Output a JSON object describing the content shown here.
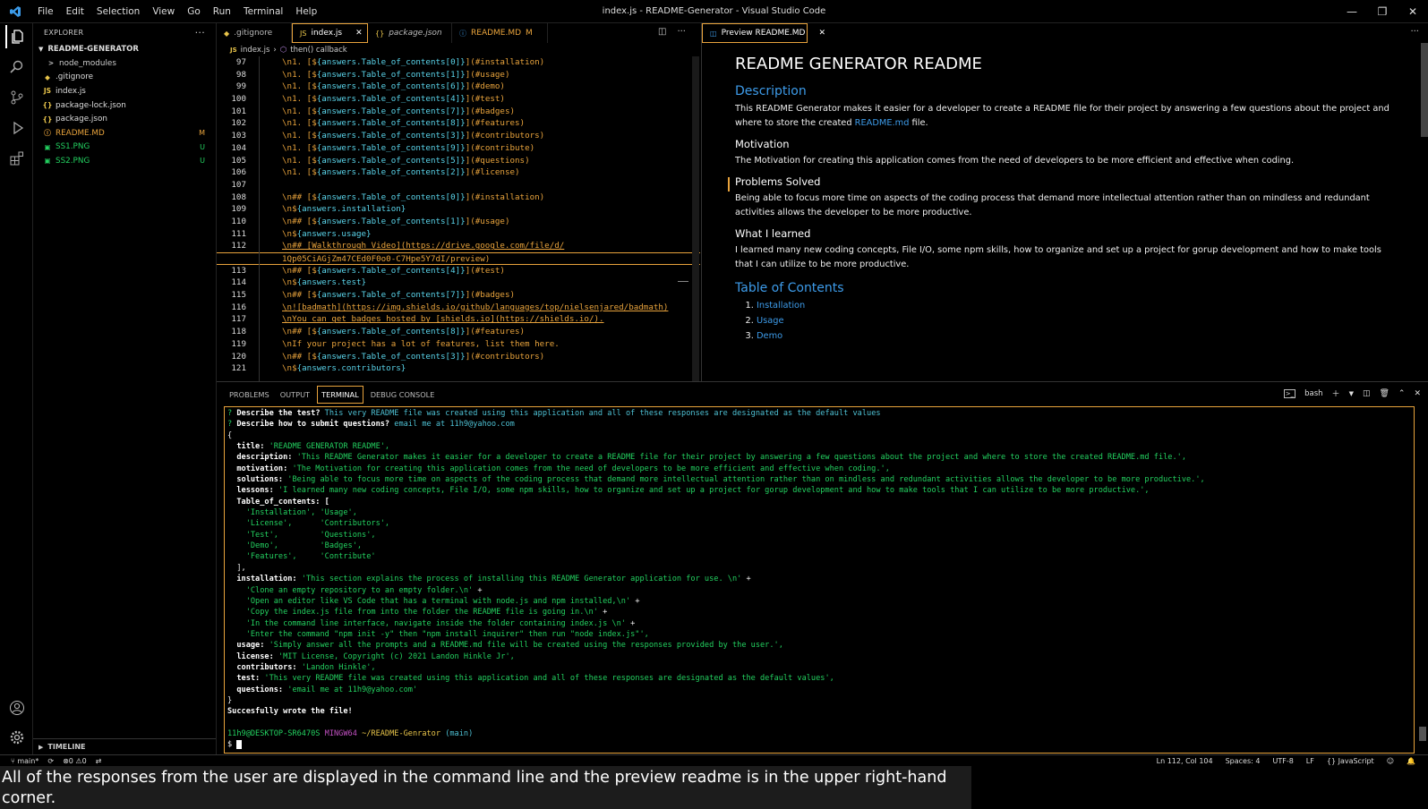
{
  "window": {
    "title": "index.js - README-Generator - Visual Studio Code",
    "menu": [
      "File",
      "Edit",
      "Selection",
      "View",
      "Go",
      "Run",
      "Terminal",
      "Help"
    ]
  },
  "sidebar": {
    "header": "EXPLORER",
    "root": "README-GENERATOR",
    "items": [
      {
        "label": "node_modules",
        "icon": ">",
        "color": "#bbbbbb",
        "badge": "",
        "badge_color": "#bbbbbb"
      },
      {
        "label": ".gitignore",
        "icon": "◆",
        "color": "#e8c44a",
        "badge": "",
        "badge_color": "#bbbbbb"
      },
      {
        "label": "index.js",
        "icon": "JS",
        "color": "#e8c44a",
        "badge": "",
        "badge_color": "#bbbbbb"
      },
      {
        "label": "package-lock.json",
        "icon": "{}",
        "color": "#e8c44a",
        "badge": "",
        "badge_color": "#bbbbbb"
      },
      {
        "label": "package.json",
        "icon": "{}",
        "color": "#e8c44a",
        "badge": "",
        "badge_color": "#bbbbbb"
      },
      {
        "label": "README.MD",
        "icon": "ⓘ",
        "color": "#e8a33c",
        "badge": "M",
        "badge_color": "#e8a33c"
      },
      {
        "label": "SS1.PNG",
        "icon": "▣",
        "color": "#23d160",
        "badge": "U",
        "badge_color": "#23d160"
      },
      {
        "label": "SS2.PNG",
        "icon": "▣",
        "color": "#23d160",
        "badge": "U",
        "badge_color": "#23d160"
      }
    ],
    "timeline": "TIMELINE"
  },
  "tabs_left": [
    {
      "label": ".gitignore",
      "icon": "◆",
      "active": false
    },
    {
      "label": "index.js",
      "icon": "JS",
      "active": true
    },
    {
      "label": "package.json",
      "icon": "{}",
      "active": false
    },
    {
      "label": "README.MD",
      "icon": "ⓘ",
      "badge": "M",
      "active": false
    }
  ],
  "tabs_right": [
    {
      "label": "Preview README.MD",
      "icon": "◫",
      "active": true
    }
  ],
  "breadcrumb": {
    "file": "index.js",
    "symbol": "then() callback"
  },
  "code": [
    {
      "n": "97",
      "a": "\\n1. [$",
      "v": "{answers.Table_of_contents[0]}",
      "b": "](#installation)"
    },
    {
      "n": "98",
      "a": "\\n1. [$",
      "v": "{answers.Table_of_contents[1]}",
      "b": "](#usage)"
    },
    {
      "n": "99",
      "a": "\\n1. [$",
      "v": "{answers.Table_of_contents[6]}",
      "b": "](#demo)"
    },
    {
      "n": "100",
      "a": "\\n1. [$",
      "v": "{answers.Table_of_contents[4]}",
      "b": "](#test)"
    },
    {
      "n": "101",
      "a": "\\n1. [$",
      "v": "{answers.Table_of_contents[7]}",
      "b": "](#badges)"
    },
    {
      "n": "102",
      "a": "\\n1. [$",
      "v": "{answers.Table_of_contents[8]}",
      "b": "](#features)"
    },
    {
      "n": "103",
      "a": "\\n1. [$",
      "v": "{answers.Table_of_contents[3]}",
      "b": "](#contributors)"
    },
    {
      "n": "104",
      "a": "\\n1. [$",
      "v": "{answers.Table_of_contents[9]}",
      "b": "](#contribute)"
    },
    {
      "n": "105",
      "a": "\\n1. [$",
      "v": "{answers.Table_of_contents[5]}",
      "b": "](#questions)"
    },
    {
      "n": "106",
      "a": "\\n1. [$",
      "v": "{answers.Table_of_contents[2]}",
      "b": "](#license)"
    },
    {
      "n": "107",
      "a": "",
      "v": "",
      "b": ""
    },
    {
      "n": "108",
      "a": "\\n## [$",
      "v": "{answers.Table_of_contents[0]}",
      "b": "](#installation)"
    },
    {
      "n": "109",
      "a": "\\n$",
      "v": "{answers.installation}",
      "b": ""
    },
    {
      "n": "110",
      "a": "\\n## [$",
      "v": "{answers.Table_of_contents[1]}",
      "b": "](#usage)"
    },
    {
      "n": "111",
      "a": "\\n$",
      "v": "{answers.usage}",
      "b": ""
    },
    {
      "n": "112",
      "a": "\\n## [Walkthrough Video](https://drive.google.com/file/d/",
      "v": "",
      "b": ""
    },
    {
      "n": "",
      "a": "1Qp05CiAGjZm47CEd0F0o0-C7Hpe5Y7dI/preview)",
      "v": "",
      "b": "",
      "cur": true
    },
    {
      "n": "113",
      "a": "\\n## [$",
      "v": "{answers.Table_of_contents[4]}",
      "b": "](#test)"
    },
    {
      "n": "114",
      "a": "\\n$",
      "v": "{answers.test}",
      "b": ""
    },
    {
      "n": "115",
      "a": "\\n## [$",
      "v": "{answers.Table_of_contents[7]}",
      "b": "](#badges)"
    },
    {
      "n": "116",
      "a": "\\n![badmath](https://img.shields.io/github/languages/top/nielsenjared/badmath)",
      "v": "",
      "b": ""
    },
    {
      "n": "117",
      "a": "\\nYou can get badges hosted by [shields.io](https://shields.io/).",
      "v": "",
      "b": ""
    },
    {
      "n": "118",
      "a": "\\n## [$",
      "v": "{answers.Table_of_contents[8]}",
      "b": "](#features)"
    },
    {
      "n": "119",
      "a": "\\nIf your project has a lot of features, list them here.",
      "v": "",
      "b": ""
    },
    {
      "n": "120",
      "a": "\\n## [$",
      "v": "{answers.Table_of_contents[3]}",
      "b": "](#contributors)"
    },
    {
      "n": "121",
      "a": "\\n$",
      "v": "{answers.contributors}",
      "b": ""
    }
  ],
  "preview": {
    "title": "README GENERATOR README",
    "desc_h": "Description",
    "desc_p1": "This README Generator makes it easier for a developer to create a README file for their project by answering a few questions about the project and where to store the created ",
    "desc_link": "README.md",
    "desc_p2": " file.",
    "motivation_h": "Motivation",
    "motivation_p": "The Motivation for creating this application comes from the need of developers to be more efficient and effective when coding.",
    "problems_h": "Problems Solved",
    "problems_p": "Being able to focus more time on aspects of the coding process that demand more intellectual attention rather than on mindless and redundant activities allows the developer to be more productive.",
    "learned_h": "What I learned",
    "learned_p": "I learned many new coding concepts, File I/O, some npm skills, how to organize and set up a project for gorup development and how to make tools that I can utilize to be more productive.",
    "toc_h": "Table of Contents",
    "toc": [
      "Installation",
      "Usage",
      "Demo"
    ]
  },
  "panel": {
    "tabs": [
      "PROBLEMS",
      "OUTPUT",
      "TERMINAL",
      "DEBUG CONSOLE"
    ],
    "active": "TERMINAL",
    "shell": "bash"
  },
  "terminal": [
    [
      {
        "c": "g",
        "t": "? "
      },
      {
        "c": "b",
        "t": "Describe the test? "
      },
      {
        "c": "c",
        "t": "This very README file was created using this application and all of these responses are designated as the default values"
      }
    ],
    [
      {
        "c": "g",
        "t": "? "
      },
      {
        "c": "b",
        "t": "Describe how to submit questions? "
      },
      {
        "c": "c",
        "t": "email me at 11h9@yahoo.com"
      }
    ],
    [
      {
        "c": "",
        "t": "{"
      }
    ],
    [
      {
        "c": "b",
        "t": "  title: "
      },
      {
        "c": "g",
        "t": "'README GENERATOR README',"
      }
    ],
    [
      {
        "c": "b",
        "t": "  description: "
      },
      {
        "c": "g",
        "t": "'This README Generator makes it easier for a developer to create a README file for their project by answering a few questions about the project and where to store the created README.md file.',"
      }
    ],
    [
      {
        "c": "b",
        "t": "  motivation: "
      },
      {
        "c": "g",
        "t": "'The Motivation for creating this application comes from the need of developers to be more efficient and effective when coding.',"
      }
    ],
    [
      {
        "c": "b",
        "t": "  solutions: "
      },
      {
        "c": "g",
        "t": "'Being able to focus more time on aspects of the coding process that demand more intellectual attention rather than on mindless and redundant activities allows the developer to be more productive.',"
      }
    ],
    [
      {
        "c": "b",
        "t": "  lessons: "
      },
      {
        "c": "g",
        "t": "'I learned many new coding concepts, File I/O, some npm skills, how to organize and set up a project for gorup development and how to make tools that I can utilize to be more productive.',"
      }
    ],
    [
      {
        "c": "b",
        "t": "  Table_of_contents: ["
      }
    ],
    [
      {
        "c": "g",
        "t": "    'Installation', 'Usage',"
      }
    ],
    [
      {
        "c": "g",
        "t": "    'License',      'Contributors',"
      }
    ],
    [
      {
        "c": "g",
        "t": "    'Test',         'Questions',"
      }
    ],
    [
      {
        "c": "g",
        "t": "    'Demo',         'Badges',"
      }
    ],
    [
      {
        "c": "g",
        "t": "    'Features',     'Contribute'"
      }
    ],
    [
      {
        "c": "",
        "t": "  ],"
      }
    ],
    [
      {
        "c": "b",
        "t": "  installation: "
      },
      {
        "c": "g",
        "t": "'This section explains the process of installing this README Generator application for use. \\n' "
      },
      {
        "c": "",
        "t": "+"
      }
    ],
    [
      {
        "c": "g",
        "t": "    'Clone an empty repository to an empty folder.\\n' "
      },
      {
        "c": "",
        "t": "+"
      }
    ],
    [
      {
        "c": "g",
        "t": "    'Open an editor like VS Code that has a terminal with node.js and npm installed,\\n' "
      },
      {
        "c": "",
        "t": "+"
      }
    ],
    [
      {
        "c": "g",
        "t": "    'Copy the index.js file from into the folder the README file is going in.\\n' "
      },
      {
        "c": "",
        "t": "+"
      }
    ],
    [
      {
        "c": "g",
        "t": "    'In the command line interface, navigate inside the folder containing index.js \\n' "
      },
      {
        "c": "",
        "t": "+"
      }
    ],
    [
      {
        "c": "g",
        "t": "    'Enter the command \"npm init -y\" then \"npm install inquirer\" then run \"node index.js\"',"
      }
    ],
    [
      {
        "c": "b",
        "t": "  usage: "
      },
      {
        "c": "g",
        "t": "'Simply answer all the prompts and a README.md file will be created using the responses provided by the user.',"
      }
    ],
    [
      {
        "c": "b",
        "t": "  license: "
      },
      {
        "c": "g",
        "t": "'MIT License, Copyright (c) 2021 Landon Hinkle Jr',"
      }
    ],
    [
      {
        "c": "b",
        "t": "  contributors: "
      },
      {
        "c": "g",
        "t": "'Landon Hinkle',"
      }
    ],
    [
      {
        "c": "b",
        "t": "  test: "
      },
      {
        "c": "g",
        "t": "'This very README file was created using this application and all of these responses are designated as the default values',"
      }
    ],
    [
      {
        "c": "b",
        "t": "  questions: "
      },
      {
        "c": "g",
        "t": "'email me at 11h9@yahoo.com'"
      }
    ],
    [
      {
        "c": "",
        "t": "}"
      }
    ],
    [
      {
        "c": "b",
        "t": "Succesfully wrote the file!"
      }
    ],
    [
      {
        "c": "",
        "t": ""
      }
    ],
    [
      {
        "c": "g",
        "t": "11h9@DESKTOP-SR6470S "
      },
      {
        "c": "m",
        "t": "MINGW64 "
      },
      {
        "c": "y",
        "t": "~/README-Genrator "
      },
      {
        "c": "c",
        "t": "(main)"
      }
    ],
    [
      {
        "c": "",
        "t": "$ "
      }
    ]
  ],
  "status": {
    "branch": "main*",
    "errors": "0",
    "warnings": "0",
    "right": [
      "Ln 112, Col 104",
      "Spaces: 4",
      "UTF-8",
      "LF",
      "{} JavaScript"
    ]
  },
  "caption": "All of the responses from the user are displayed in the command line and the preview readme is in the upper right-hand corner."
}
